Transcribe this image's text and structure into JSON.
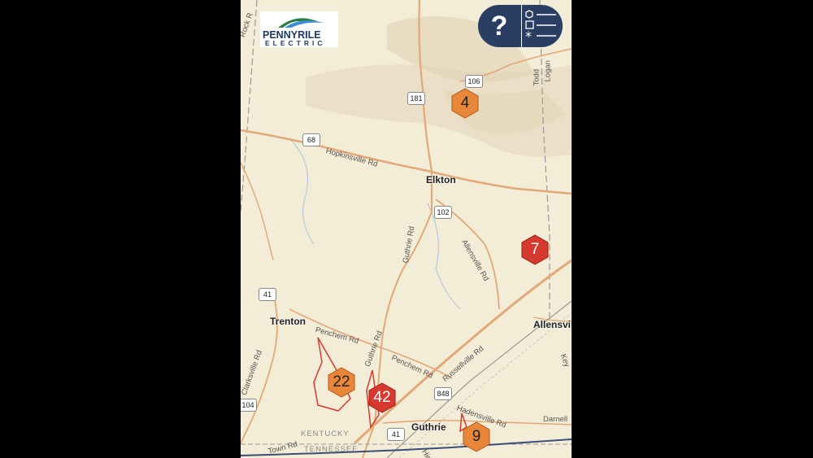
{
  "logo": {
    "line1": "PENNYRILE",
    "line2": "ELECTRIC"
  },
  "controls": {
    "help_symbol": "?",
    "legend_icon": "legend-list-icon"
  },
  "places": {
    "elkton": "Elkton",
    "trenton": "Trenton",
    "guthrie": "Guthrie",
    "allensville": "Allensvil"
  },
  "roads": {
    "hopkinsville": "Hopkinsville Rd",
    "guthrie_rd": "Guthrie Rd",
    "allensville_rd": "Allensville Rd",
    "penchem_1": "Penchem Rd",
    "penchem_2": "Penchem Rd",
    "guthrie_rd_2": "Guthrie Rd",
    "russellville": "Russellville Rd",
    "clarksville": "Clarksville Rd",
    "hadensville": "Hadensville Rd",
    "darnell": "Darnell",
    "rock": "Rock R",
    "todd": "Todd",
    "logan": "Logan",
    "town": "Town Rd",
    "hig": "Hig",
    "kev": "Key",
    "rd_left": "Rd",
    "gr_rd": "ctl"
  },
  "shields": {
    "s106": "106",
    "s181": "181",
    "s68": "68",
    "s102": "102",
    "s41a": "41",
    "s848": "848",
    "s41b": "41",
    "s104": "104"
  },
  "states": {
    "ky": "KENTUCKY",
    "tn": "TENNESSEE"
  },
  "clusters": [
    {
      "count": "4",
      "color": "#e8873a"
    },
    {
      "count": "7",
      "color": "#d63a2e"
    },
    {
      "count": "22",
      "color": "#e8873a"
    },
    {
      "count": "42",
      "color": "#d63a2e"
    },
    {
      "count": "9",
      "color": "#e8873a"
    }
  ]
}
